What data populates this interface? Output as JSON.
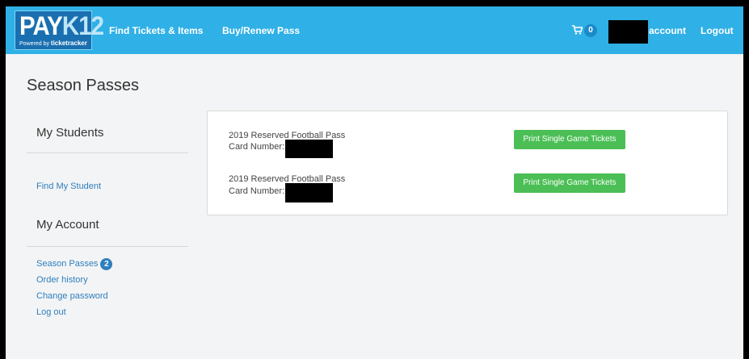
{
  "brand": {
    "logo_main_left": "PAY",
    "logo_main_right": "K12",
    "logo_powered_by": "Powered by",
    "logo_powered_name": "ticketracker"
  },
  "nav": {
    "find_tickets": "Find Tickets & Items",
    "buy_pass": "Buy/Renew Pass",
    "cart_count": "0",
    "account": "account",
    "logout": "Logout"
  },
  "page": {
    "title": "Season Passes"
  },
  "sidebar": {
    "students_heading": "My Students",
    "find_student": "Find My Student",
    "account_heading": "My Account",
    "links": {
      "season_passes": "Season Passes",
      "season_passes_count": "2",
      "order_history": "Order history",
      "change_password": "Change password",
      "log_out": "Log out"
    }
  },
  "passes": [
    {
      "name": "2019 Reserved Football Pass",
      "card_label": "Card Number:",
      "button": "Print Single Game Tickets"
    },
    {
      "name": "2019 Reserved Football Pass",
      "card_label": "Card Number:",
      "button": "Print Single Game Tickets"
    }
  ],
  "colors": {
    "navbar": "#2fb0e6",
    "button_green": "#4bbf55",
    "link_blue": "#2e7fbf",
    "page_bg": "#f3f4f5"
  }
}
